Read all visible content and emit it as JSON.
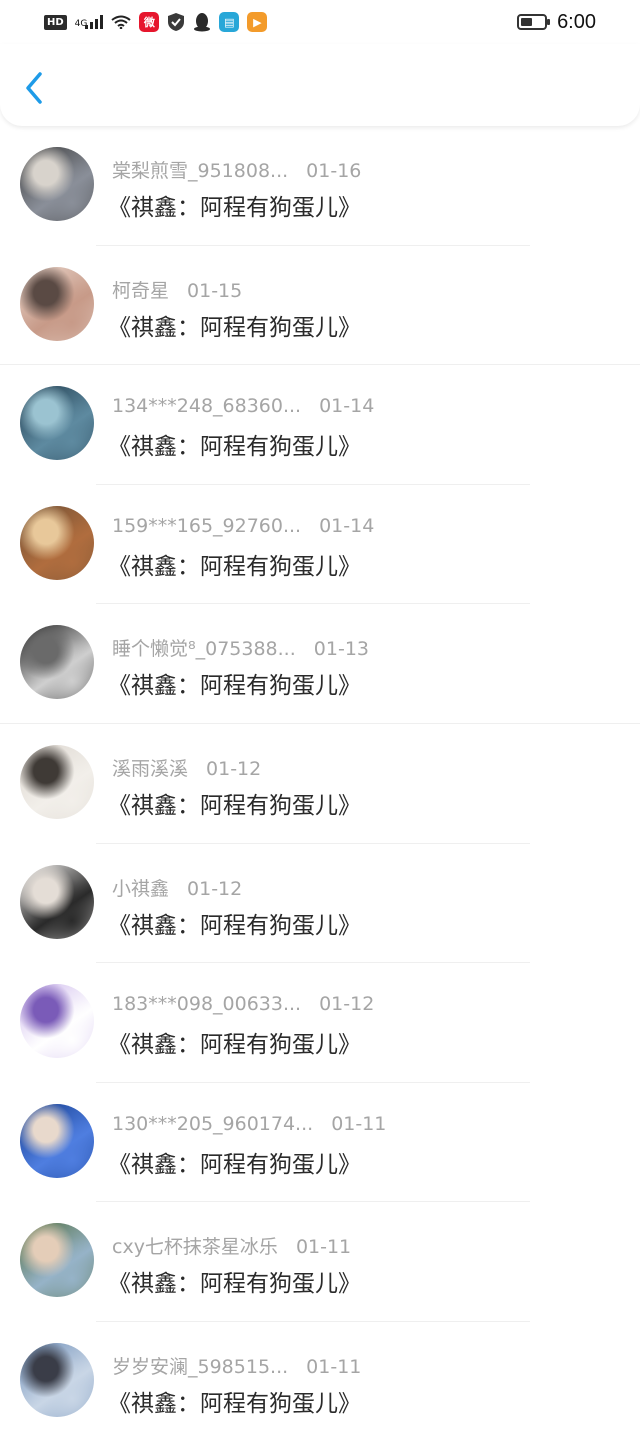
{
  "status_bar": {
    "network_badge": "HD",
    "signal_label": "4G",
    "time": "6:00",
    "icons": [
      "hd-icon",
      "signal-icon",
      "wifi-icon",
      "weibo-icon",
      "shield-icon",
      "qq-icon",
      "reader-icon",
      "video-icon",
      "battery-icon"
    ]
  },
  "nav": {
    "back_icon": "chevron-left-icon",
    "accent": "#1e9be8"
  },
  "items": [
    {
      "user": "棠梨煎雪_951808...",
      "date": "01-16",
      "title": "《祺鑫：阿程有狗蛋儿》",
      "avatar_colors": [
        "#3b3b3b",
        "#8a8f99",
        "#d8d3cc"
      ]
    },
    {
      "user": "柯奇星",
      "date": "01-15",
      "title": "《祺鑫：阿程有狗蛋儿》",
      "avatar_colors": [
        "#e9d7cd",
        "#c79a88",
        "#5a4a44"
      ]
    },
    {
      "user": "134***248_68360...",
      "date": "01-14",
      "title": "《祺鑫：阿程有狗蛋儿》",
      "avatar_colors": [
        "#1f3a4c",
        "#5e8aa0",
        "#9bc3d1"
      ]
    },
    {
      "user": "159***165_92760...",
      "date": "01-14",
      "title": "《祺鑫：阿程有狗蛋儿》",
      "avatar_colors": [
        "#6d4f35",
        "#b06d3e",
        "#e8c89a"
      ]
    },
    {
      "user": "睡个懒觉⁸_075388...",
      "date": "01-13",
      "title": "《祺鑫：阿程有狗蛋儿》",
      "avatar_colors": [
        "#1b1b1b",
        "#cfcfcf",
        "#6a6a6a"
      ]
    },
    {
      "user": "溪雨溪溪",
      "date": "01-12",
      "title": "《祺鑫：阿程有狗蛋儿》",
      "avatar_colors": [
        "#dcd6cf",
        "#f2efea",
        "#3f3a36"
      ]
    },
    {
      "user": "小祺鑫",
      "date": "01-12",
      "title": "《祺鑫：阿程有狗蛋儿》",
      "avatar_colors": [
        "#f7f5f3",
        "#2a2a2a",
        "#e4ddd6"
      ]
    },
    {
      "user": "183***098_00633...",
      "date": "01-12",
      "title": "《祺鑫：阿程有狗蛋儿》",
      "avatar_colors": [
        "#cdb8ec",
        "#ffffff",
        "#7a5bb8"
      ]
    },
    {
      "user": "130***205_960174...",
      "date": "01-11",
      "title": "《祺鑫：阿程有狗蛋儿》",
      "avatar_colors": [
        "#123a8a",
        "#4f7ee0",
        "#e8d9cc"
      ]
    },
    {
      "user": "cxy七杯抹茶星冰乐",
      "date": "01-11",
      "title": "《祺鑫：阿程有狗蛋儿》",
      "avatar_colors": [
        "#4f6b3a",
        "#96b3c8",
        "#e4cdb8"
      ]
    },
    {
      "user": "岁岁安澜_598515...",
      "date": "01-11",
      "title": "《祺鑫：阿程有狗蛋儿》",
      "avatar_colors": [
        "#6f8fb8",
        "#c9d6e6",
        "#3a3d48"
      ]
    }
  ]
}
